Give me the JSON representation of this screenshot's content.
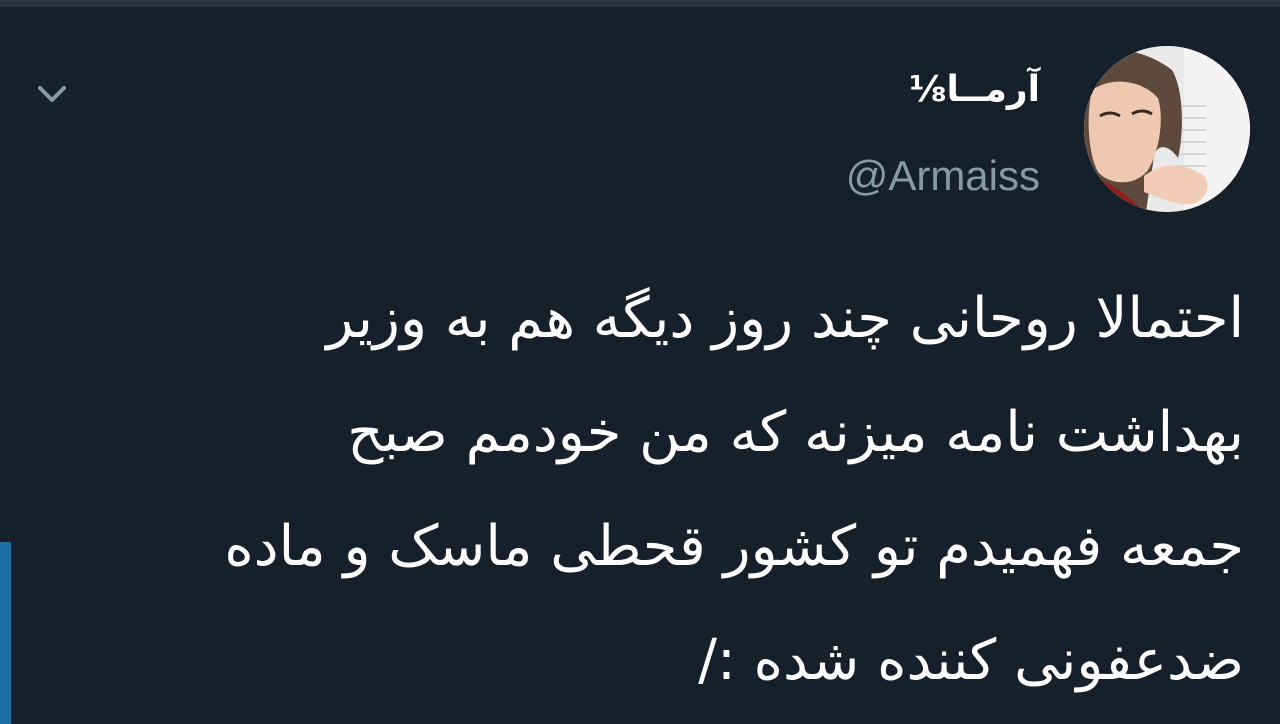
{
  "tweet": {
    "author": {
      "display_name": "آرمــا⅛",
      "handle": "@Armaiss"
    },
    "text_lines": [
      "احتمالا روحانی چند روز دیگه هم به وزیر",
      "بهداشت نامه میزنه که من خودمم صبح",
      "جمعه فهمیدم تو کشور قحطی ماسک و ماده",
      "ضدعفونی کننده شده :/"
    ]
  },
  "icons": {
    "menu": "chevron-down-icon",
    "profile": "avatar"
  },
  "colors": {
    "background": "#15202b",
    "text": "#ffffff",
    "secondary_text": "#8899a6",
    "accent": "#1d6fa5"
  }
}
